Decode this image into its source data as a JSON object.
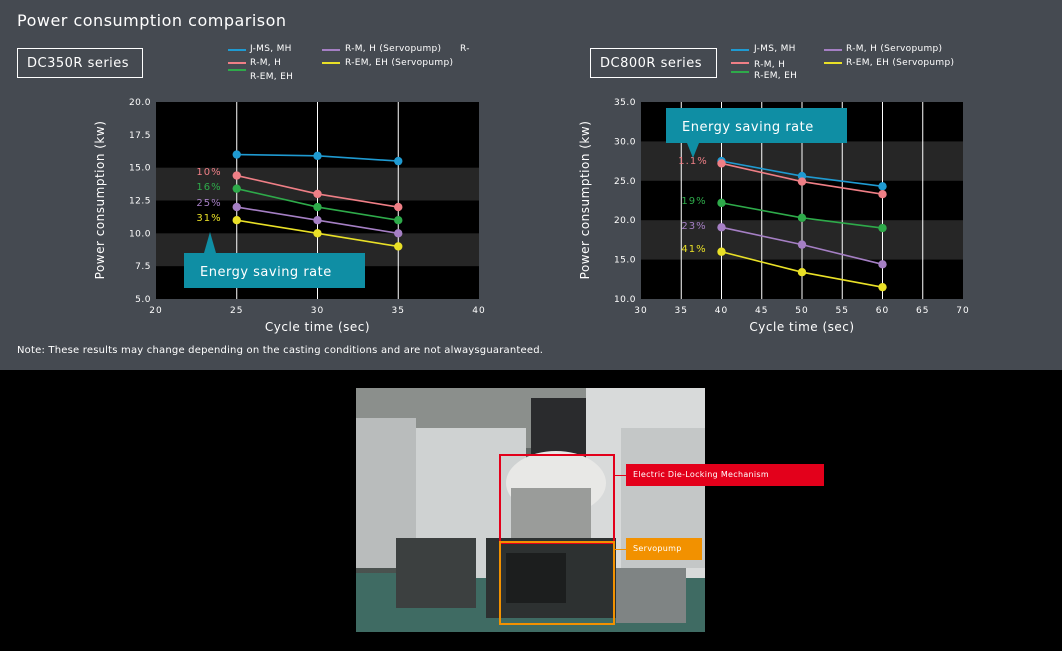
{
  "page": {
    "title": "Power consumption comparison",
    "note": "Note: These results may change depending on the casting conditions and are not alwaysguaranteed."
  },
  "colors": {
    "panel": "#454a51",
    "plot_bg": "#000000",
    "band": "#262626",
    "callout_teal": "#0f8ea4",
    "js_ms": "#1f9ad1",
    "rm_h": "#ef7f86",
    "rem_eh": "#2eaa4a",
    "rm_h_servo": "#a57fc4",
    "rem_eh_servo": "#e9e027",
    "die_locking_red": "#e3001b",
    "servopump_orange": "#f29100"
  },
  "legend": [
    {
      "label": "J-MS, MH",
      "color": "#1f9ad1"
    },
    {
      "label": "R-M, H",
      "color": "#ef7f86"
    },
    {
      "label": "R-EM, EH",
      "color": "#2eaa4a"
    },
    {
      "label": "R-M, H  (Servopump)",
      "color": "#a57fc4"
    },
    {
      "label": "R-EM, EH (Servopump)",
      "color": "#e9e027"
    }
  ],
  "legend_trailing_text": "R-",
  "chart_data": [
    {
      "type": "line",
      "series_box": "DC350R series",
      "xlabel": "Cycle time (sec)",
      "ylabel": "Power consumption  (kw)",
      "xlim": [
        20,
        40
      ],
      "ylim": [
        5,
        20
      ],
      "xticks": [
        "20",
        "25",
        "30",
        "35",
        "40"
      ],
      "yticks": [
        "5.0",
        "7.5",
        "10.0",
        "12.5",
        "15.0",
        "17.5",
        "20.0"
      ],
      "grid": "vertical lines",
      "x": [
        25,
        30,
        35
      ],
      "series": [
        {
          "name": "J-MS, MH",
          "values": [
            16.0,
            15.9,
            15.5
          ]
        },
        {
          "name": "R-M, H",
          "values": [
            14.4,
            13.0,
            12.0
          ]
        },
        {
          "name": "R-EM, EH",
          "values": [
            13.4,
            12.0,
            11.0
          ]
        },
        {
          "name": "R-M, H  (Servopump)",
          "values": [
            12.0,
            11.0,
            10.0
          ]
        },
        {
          "name": "R-EM, EH (Servopump)",
          "values": [
            11.0,
            10.0,
            9.0
          ]
        }
      ],
      "rate_labels": [
        "10%",
        "16%",
        "25%",
        "31%"
      ],
      "annotation": "Energy saving rate"
    },
    {
      "type": "line",
      "series_box": "DC800R series",
      "xlabel": "Cycle time (sec)",
      "ylabel": "Power consumption  (kw)",
      "xlim": [
        30,
        70
      ],
      "ylim": [
        10,
        35
      ],
      "xticks": [
        "30",
        "35",
        "40",
        "45",
        "50",
        "55",
        "60",
        "65",
        "70"
      ],
      "yticks": [
        "10.0",
        "15.0",
        "20.0",
        "25.0",
        "30.0",
        "35.0"
      ],
      "grid": "vertical lines",
      "x": [
        40,
        50,
        60
      ],
      "series": [
        {
          "name": "J-MS, MH",
          "values": [
            27.5,
            25.6,
            24.3
          ]
        },
        {
          "name": "R-M, H",
          "values": [
            27.2,
            24.9,
            23.3
          ]
        },
        {
          "name": "R-EM, EH",
          "values": [
            22.2,
            20.3,
            19.0
          ]
        },
        {
          "name": "R-M, H  (Servopump)",
          "values": [
            19.1,
            16.9,
            14.4
          ]
        },
        {
          "name": "R-EM, EH (Servopump)",
          "values": [
            16.0,
            13.4,
            11.5
          ]
        }
      ],
      "rate_labels": [
        "1.1%",
        "19%",
        "23%",
        "41%"
      ],
      "annotation": "Energy saving rate"
    }
  ],
  "photo": {
    "callouts": [
      {
        "label": "Electric Die-Locking Mechanism",
        "color": "#e3001b"
      },
      {
        "label": "Servopump",
        "color": "#f29100"
      }
    ]
  }
}
